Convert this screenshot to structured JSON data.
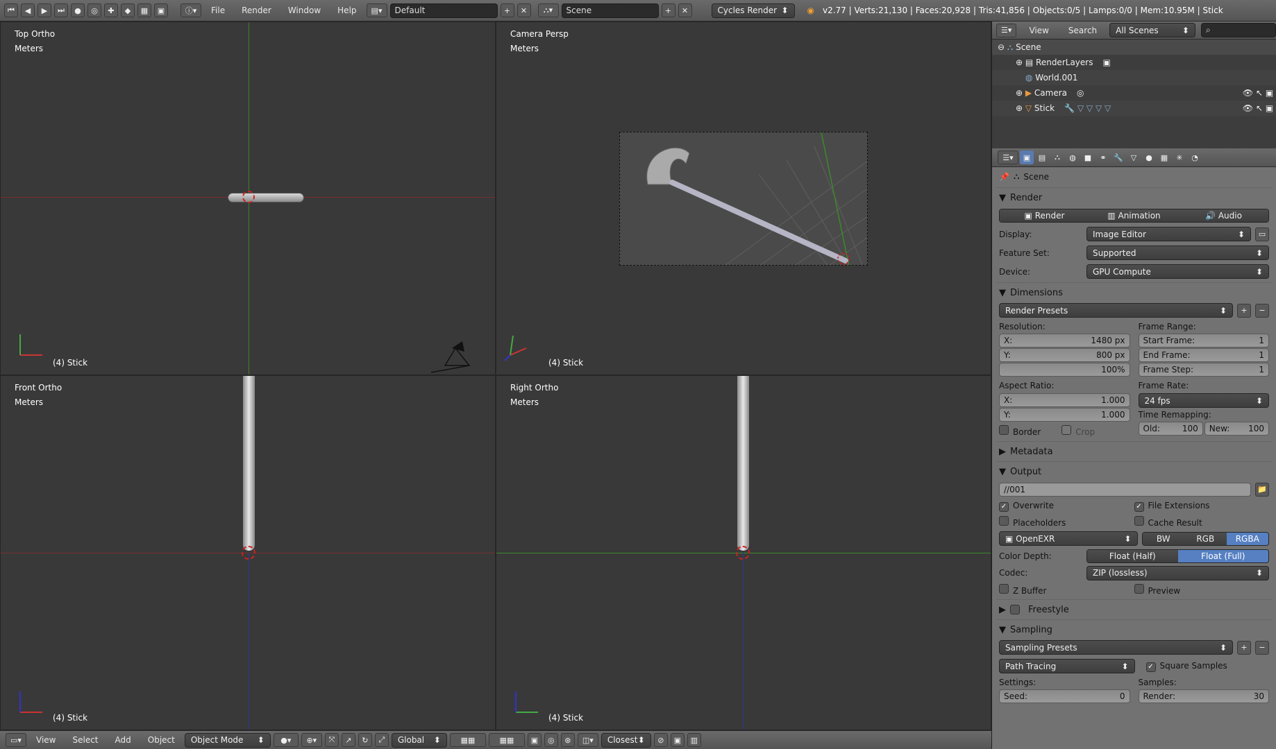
{
  "menu": {
    "items": [
      "File",
      "Render",
      "Window",
      "Help"
    ]
  },
  "layout": {
    "name": "Default"
  },
  "scene": {
    "name": "Scene"
  },
  "engine": {
    "name": "Cycles Render"
  },
  "status": {
    "text": "v2.77 | Verts:21,130 | Faces:20,928 | Tris:41,856 | Objects:0/5 | Lamps:0/0 | Mem:10.95M | Stick"
  },
  "viewports": {
    "top": {
      "name": "Top Ortho",
      "units": "Meters",
      "object": "(4) Stick"
    },
    "camera": {
      "name": "Camera Persp",
      "units": "Meters",
      "object": "(4) Stick"
    },
    "front": {
      "name": "Front Ortho",
      "units": "Meters",
      "object": "(4) Stick"
    },
    "right": {
      "name": "Right Ortho",
      "units": "Meters",
      "object": "(4) Stick"
    }
  },
  "bottombar": {
    "items": [
      "View",
      "Select",
      "Add",
      "Object"
    ],
    "mode": "Object Mode",
    "orientation": "Global",
    "snap": "Closest"
  },
  "outliner": {
    "header": [
      "View",
      "Search"
    ],
    "filter": "All Scenes",
    "rows": [
      "Scene",
      "RenderLayers",
      "World.001",
      "Camera",
      "Stick"
    ]
  },
  "properties": {
    "context": "Scene",
    "render": {
      "title": "Render",
      "buttons": [
        "Render",
        "Animation",
        "Audio"
      ],
      "display_label": "Display:",
      "display": "Image Editor",
      "featureset_label": "Feature Set:",
      "featureset": "Supported",
      "device_label": "Device:",
      "device": "GPU Compute"
    },
    "dimensions": {
      "title": "Dimensions",
      "presets": "Render Presets",
      "resolution_label": "Resolution:",
      "res_x_label": "X:",
      "res_x": "1480 px",
      "res_y_label": "Y:",
      "res_y": "800 px",
      "res_pct": "100%",
      "frame_range_label": "Frame Range:",
      "start_label": "Start Frame:",
      "start": "1",
      "end_label": "End Frame:",
      "end": "1",
      "step_label": "Frame Step:",
      "step": "1",
      "aspect_label": "Aspect Ratio:",
      "asp_x_label": "X:",
      "asp_x": "1.000",
      "asp_y_label": "Y:",
      "asp_y": "1.000",
      "framerate_label": "Frame Rate:",
      "framerate": "24 fps",
      "remap_label": "Time Remapping:",
      "old_label": "Old:",
      "old": "100",
      "new_label": "New:",
      "new": "100",
      "border": "Border",
      "crop": "Crop"
    },
    "metadata": {
      "title": "Metadata"
    },
    "output": {
      "title": "Output",
      "path": "//001",
      "overwrite": "Overwrite",
      "file_ext": "File Extensions",
      "placeholders": "Placeholders",
      "cache": "Cache Result",
      "format": "OpenEXR",
      "channels": [
        "BW",
        "RGB",
        "RGBA"
      ],
      "depth_label": "Color Depth:",
      "depth": [
        "Float (Half)",
        "Float (Full)"
      ],
      "codec_label": "Codec:",
      "codec": "ZIP (lossless)",
      "zbuffer": "Z Buffer",
      "preview": "Preview"
    },
    "freestyle": {
      "title": "Freestyle"
    },
    "sampling": {
      "title": "Sampling",
      "presets": "Sampling Presets",
      "integrator": "Path Tracing",
      "square": "Square Samples",
      "settings_label": "Settings:",
      "samples_label": "Samples:",
      "seed_label": "Seed:",
      "seed": "0",
      "render_label": "Render:",
      "render": "30"
    }
  },
  "colors": {
    "x_axis": "#8a2a2a",
    "y_axis": "#3a8a2a",
    "z_axis": "#2a3a9a",
    "accent": "#5680c2"
  }
}
